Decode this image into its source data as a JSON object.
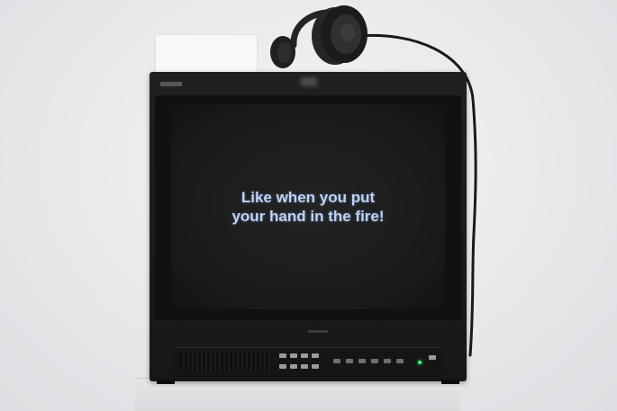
{
  "screen": {
    "caption": [
      "Like when you put",
      "your hand in the fire!"
    ]
  },
  "colors": {
    "caption_text": "#bcd3f7",
    "tv_body": "#1c1c1d",
    "wall": "#e8e9eb",
    "power_led": "#3cff7a"
  },
  "icons": [
    "headphones-icon",
    "headphone-cable-icon"
  ]
}
